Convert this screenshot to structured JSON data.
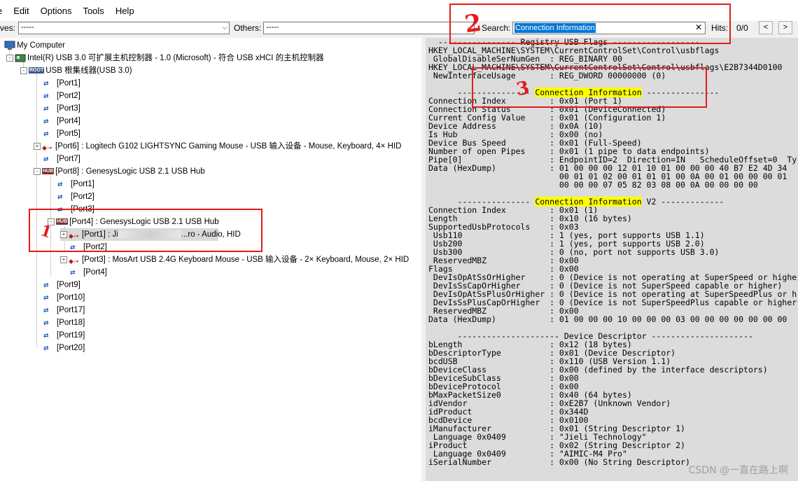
{
  "menu": {
    "items": [
      "e",
      "Edit",
      "Options",
      "Tools",
      "Help"
    ]
  },
  "toolbar": {
    "devices_label": "ves:",
    "devices_value": "-----",
    "others_label": "Others:",
    "others_value": "-----",
    "search_label": "Search:",
    "search_value": "Connection Information",
    "hits_label": "Hits:",
    "hits_value": "0/0",
    "prev_label": "<",
    "next_label": ">"
  },
  "tree": {
    "my_computer": "My Computer",
    "controller": "Intel(R) USB 3.0 可扩展主机控制器 - 1.0 (Microsoft) - 符合 USB xHCI 的主机控制器",
    "root_hub": "USB 根集线器(USB 3.0)",
    "ports_top": [
      "[Port1]",
      "[Port2]",
      "[Port3]",
      "[Port4]",
      "[Port5]"
    ],
    "port6": "[Port6] : Logitech G102 LIGHTSYNC Gaming Mouse - USB 输入设备 - Mouse, Keyboard, 4× HID",
    "port7": "[Port7]",
    "port8": "[Port8] : GenesysLogic USB 2.1 USB Hub",
    "hub8_ports": [
      "[Port1]",
      "[Port2]",
      "[Port3]"
    ],
    "port8_4": "[Port4] : GenesysLogic USB 2.1 USB Hub",
    "hub84_port1_prefix": "[Port1] : Ji",
    "hub84_port1_suffix": "...ro - Audio, HID",
    "hub84_port2": "[Port2]",
    "hub8_port3_dev": "[Port3] : MosArt USB 2.4G Keyboard Mouse - USB 输入设备 - 2× Keyboard, Mouse, 2× HID",
    "hub8_port4": "[Port4]",
    "ports_bottom": [
      "[Port9]",
      "[Port10]",
      "[Port17]",
      "[Port18]",
      "[Port19]",
      "[Port20]"
    ]
  },
  "details": {
    "lines": [
      "  ---------------- Registry USB Flags ------------------",
      "HKEY_LOCAL_MACHINE\\SYSTEM\\CurrentControlSet\\Control\\usbflags",
      " GlobalDisableSerNumGen  : REG_BINARY 00",
      "HKEY_LOCAL_MACHINE\\SYSTEM\\CurrentControlSet\\Control\\usbflags\\E2B7344D0100",
      " NewInterfaceUsage       : REG_DWORD 00000000 (0)",
      "",
      "      --------------- Connection Information ---------------",
      "Connection Index         : 0x01 (Port 1)",
      "Connection Status        : 0x01 (DeviceConnected)",
      "Current Config Value     : 0x01 (Configuration 1)",
      "Device Address           : 0x0A (10)",
      "Is Hub                   : 0x00 (no)",
      "Device Bus Speed         : 0x01 (Full-Speed)",
      "Number of open Pipes     : 0x01 (1 pipe to data endpoints)",
      "Pipe[0]                  : EndpointID=2  Direction=IN   ScheduleOffset=0  Ty",
      "Data (HexDump)           : 01 00 00 00 12 01 10 01 00 00 00 40 B7 E2 4D 34",
      "                           00 01 01 02 00 01 01 01 00 0A 00 01 00 00 00 01",
      "                           00 00 00 07 05 82 03 08 00 0A 00 00 00 00",
      "",
      "      --------------- Connection Information V2 -------------",
      "Connection Index         : 0x01 (1)",
      "Length                   : 0x10 (16 bytes)",
      "SupportedUsbProtocols    : 0x03",
      " Usb110                  : 1 (yes, port supports USB 1.1)",
      " Usb200                  : 1 (yes, port supports USB 2.0)",
      " Usb300                  : 0 (no, port not supports USB 3.0)",
      " ReservedMBZ             : 0x00",
      "Flags                    : 0x00",
      " DevIsOpAtSsOrHigher     : 0 (Device is not operating at SuperSpeed or highe",
      " DevIsSsCapOrHigher      : 0 (Device is not SuperSpeed capable or higher)",
      " DevIsOpAtSsPlusOrHigher : 0 (Device is not operating at SuperSpeedPlus or h",
      " DevIsSsPlusCapOrHigher  : 0 (Device is not SuperSpeedPlus capable or higher",
      " ReservedMBZ             : 0x00",
      "Data (HexDump)           : 01 00 00 00 10 00 00 00 03 00 00 00 00 00 00 00",
      "",
      "      --------------------- Device Descriptor ---------------------",
      "bLength                  : 0x12 (18 bytes)",
      "bDescriptorType          : 0x01 (Device Descriptor)",
      "bcdUSB                   : 0x110 (USB Version 1.1)",
      "bDeviceClass             : 0x00 (defined by the interface descriptors)",
      "bDeviceSubClass          : 0x00",
      "bDeviceProtocol          : 0x00",
      "bMaxPacketSize0          : 0x40 (64 bytes)",
      "idVendor                 : 0xE2B7 (Unknown Vendor)",
      "idProduct                : 0x344D",
      "bcdDevice                : 0x0100",
      "iManufacturer            : 0x01 (String Descriptor 1)",
      " Language 0x0409         : \"Jieli Technology\"",
      "iProduct                 : 0x02 (String Descriptor 2)",
      " Language 0x0409         : \"AIMIC-M4 Pro\"",
      "iSerialNumber            : 0x00 (No String Descriptor)"
    ],
    "highlight": "Connection Information"
  },
  "annotations": {
    "mark1": "1",
    "mark2": "2",
    "mark3": "3",
    "color": "#e41b1b"
  },
  "watermark": "CSDN @一直在路上啊"
}
